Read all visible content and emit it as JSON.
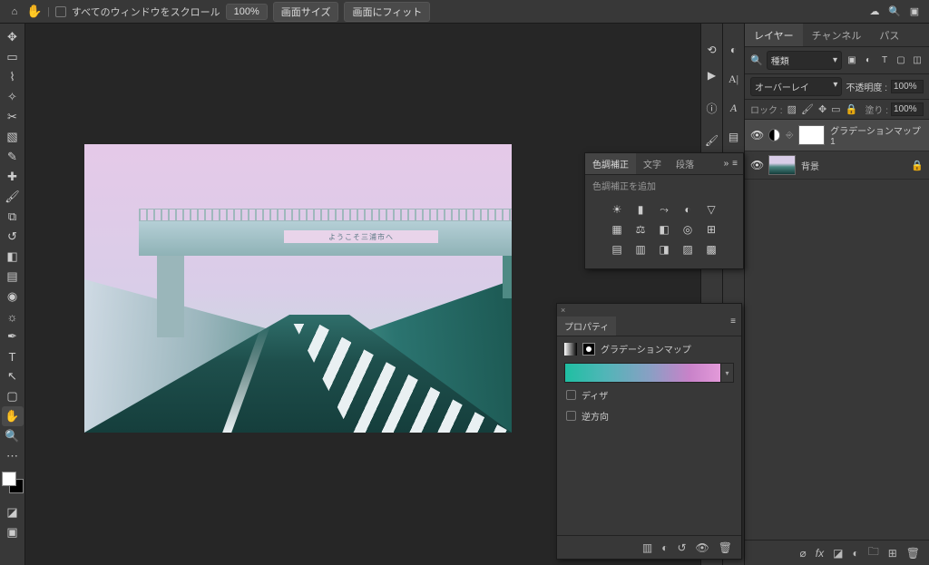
{
  "topbar": {
    "scroll_all_label": "すべてのウィンドウをスクロール",
    "zoom": "100%",
    "actual_size": "画面サイズ",
    "fit_screen": "画面にフィット"
  },
  "photo": {
    "banner_text": "ようこそ三浦市へ"
  },
  "adjustments_panel": {
    "tabs": [
      "色調補正",
      "文字",
      "段落"
    ],
    "active_tab": 0,
    "hint": "色調補正を追加"
  },
  "properties_panel": {
    "tab": "プロパティ",
    "title": "グラデーションマップ",
    "dither": "ディザ",
    "reverse": "逆方向"
  },
  "layers_panel": {
    "tabs": [
      "レイヤー",
      "チャンネル",
      "パス"
    ],
    "active_tab": 0,
    "search_kind": "種類",
    "blend_mode": "オーバーレイ",
    "opacity_label": "不透明度 :",
    "opacity_value": "100%",
    "lock_label": "ロック :",
    "fill_label": "塗り :",
    "fill_value": "100%",
    "layers": [
      {
        "name": "グラデーションマップ 1",
        "type": "adjustment",
        "selected": true
      },
      {
        "name": "背景",
        "type": "image",
        "locked": true
      }
    ]
  }
}
